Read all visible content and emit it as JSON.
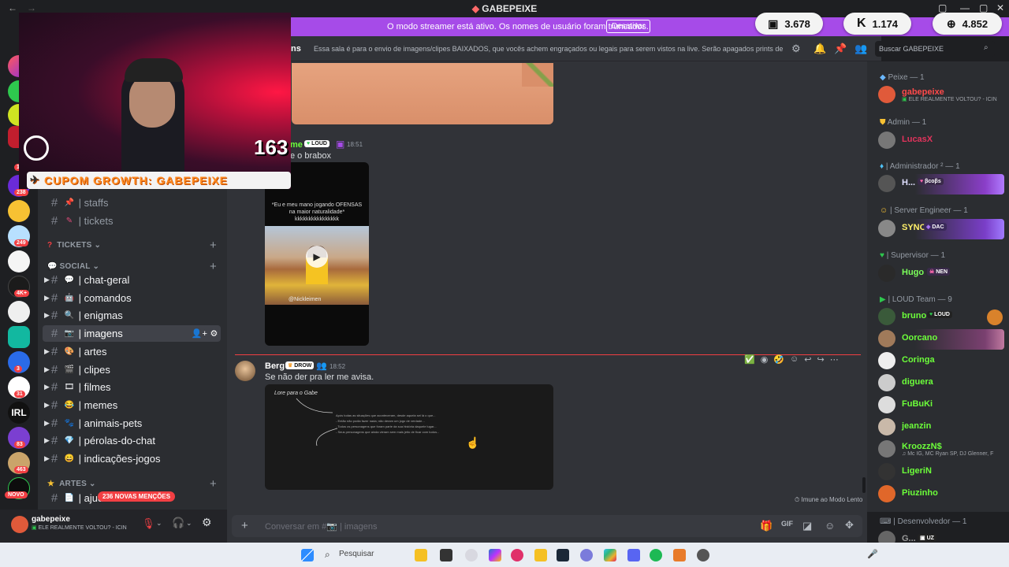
{
  "window": {
    "title": "GABEPEIXE"
  },
  "streamer_banner": {
    "message": "O modo streamer está ativo. Os nomes de usuário foram truncados.",
    "button": "Desativar"
  },
  "stats": [
    {
      "icon": "twitch-icon",
      "value": "3.678"
    },
    {
      "icon": "kick-icon",
      "value": "1.174"
    },
    {
      "icon": "globe-icon",
      "value": "4.852"
    }
  ],
  "overlay": {
    "coupon": "CUPOM GROWTH: GABEPEIXE",
    "counter": "163"
  },
  "server_badges": [
    "12k",
    "238",
    "249",
    "4K+",
    "3",
    "31",
    "83",
    "463"
  ],
  "server_labels": {
    "irl": "IRL",
    "new": "NOVO"
  },
  "channels": {
    "top": [
      "| staffs",
      "| tickets"
    ],
    "cat_tickets": "TICKETS",
    "cat_social": "SOCIAL",
    "social": [
      "| chat-geral",
      "| comandos",
      "| enigmas",
      "| imagens",
      "| artes",
      "| clipes",
      "| filmes",
      "| memes",
      "| animais-pets",
      "| pérolas-do-chat",
      "| indicações-jogos"
    ],
    "cat_artes": "ARTES",
    "artes_first": "| ajud",
    "mentions": "236 NOVAS MENÇÕES"
  },
  "header": {
    "channel_name": "ns",
    "topic": "Essa sala é para o envio de imagens/clipes BAIXADOS, que vocês achem engraçados ou legais para serem vistos na live. Serão apagados prints de o...",
    "search_placeholder": "Buscar GABEPEIXE"
  },
  "messages": [
    {
      "author": "me",
      "tag": "LOUD",
      "time": "18:51",
      "text": "e o brabox",
      "video_caption": "*Eu e meu mano jogando OFENSAS na maior naturalidade* kkkkkkkkkkkkkkkk",
      "video_watermark": "@Nickleimen"
    },
    {
      "author": "Berg",
      "tag": "DROW",
      "time": "18:52",
      "text": "Se não der pra ler me avisa.",
      "image_title": "Lore para o Gabe",
      "image_lines": [
        "Após todas as situações que aconteceram, desde aquela sei lá o que...",
        "- Então não podia fazer nada; não deram um jogo de verdade...",
        "- Todos os personagens que foram parte da sua história daquele lugar...",
        "- Seus personagens que ainda vieram sem mais jeito de ficar com todos..."
      ]
    }
  ],
  "slow_mode": "Imune ao Modo Lento",
  "input": {
    "placeholder": "Conversar em #📷 | imagens"
  },
  "user": {
    "name": "gabepeixe",
    "status": "ELE REALMENTE VOLTOU? - ICIN"
  },
  "members": {
    "groups": [
      {
        "label": "Peixe — 1",
        "members": [
          {
            "name": "gabepeixe",
            "sub": "ELE REALMENTE VOLTOU? - ICIN",
            "color": "#ff4a4a"
          }
        ]
      },
      {
        "label": "Admin — 1",
        "members": [
          {
            "name": "LucasX",
            "color": "#e2335c"
          }
        ]
      },
      {
        "label": "| Administrador ² — 1",
        "members": [
          {
            "name": "H...",
            "tag": "βcoβs",
            "color": "#e0e0ff"
          }
        ]
      },
      {
        "label": "| Server Engineer — 1",
        "members": [
          {
            "name": "SYNC",
            "tag": "DAC",
            "color": "#fff06a"
          }
        ]
      },
      {
        "label": "| Supervisor — 1",
        "members": [
          {
            "name": "Hugo",
            "tag": "NEN",
            "color": "#7bff5a"
          }
        ]
      },
      {
        "label": "| LOUD Team — 9",
        "members": [
          {
            "name": "bruno",
            "tag": "LOUD",
            "color": "#6cff3a"
          },
          {
            "name": "Oorcano",
            "color": "#6cff3a"
          },
          {
            "name": "Coringa",
            "color": "#6cff3a"
          },
          {
            "name": "diguera",
            "color": "#6cff3a"
          },
          {
            "name": "FuBuKi",
            "color": "#6cff3a"
          },
          {
            "name": "jeanzin",
            "color": "#6cff3a"
          },
          {
            "name": "KroozzN$",
            "sub": "Mc IG, MC Ryan SP, DJ Glenner, F",
            "color": "#6cff3a"
          },
          {
            "name": "LigeriN",
            "color": "#6cff3a"
          },
          {
            "name": "Piuzinho",
            "color": "#6cff3a"
          }
        ]
      },
      {
        "label": "| Desenvolvedor — 1",
        "members": [
          {
            "name": "G...",
            "tag": "UZ",
            "color": "#999"
          }
        ]
      }
    ]
  },
  "taskbar": {
    "search": "Pesquisar"
  },
  "colors": {
    "accent": "#a64be8",
    "brand_green": "#6cff3a",
    "danger": "#f23f43"
  }
}
